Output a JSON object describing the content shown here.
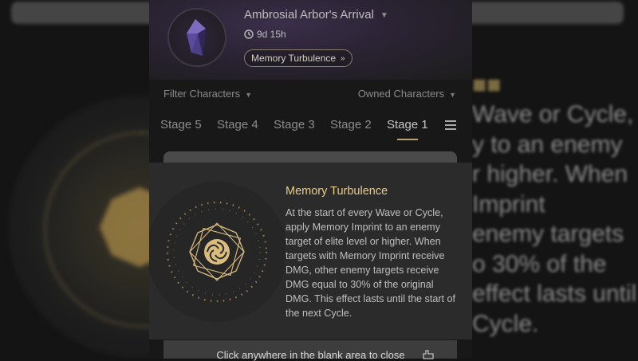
{
  "event": {
    "title": "Ambrosial Arbor's Arrival",
    "time_remaining": "9d 15h",
    "buff_pill": "Memory Turbulence"
  },
  "filters": {
    "left": "Filter Characters",
    "right": "Owned Characters"
  },
  "tabs": [
    "Stage 5",
    "Stage 4",
    "Stage 3",
    "Stage 2",
    "Stage 1"
  ],
  "active_tab": "Stage 1",
  "modal": {
    "title": "Memory Turbulence",
    "description": "At the start of every Wave or Cycle, apply Memory Imprint to an enemy target of elite level or higher. When targets with Memory Imprint receive DMG, other enemy targets receive DMG equal to 30% of the original DMG. This effect lasts until the start of the next Cycle."
  },
  "close_hint": "Click anywhere in the blank area to close",
  "background_text": [
    "Wave or Cycle,",
    "y to an enemy",
    "r higher. When",
    "Imprint",
    "enemy targets",
    "o 30% of the",
    "effect lasts until",
    "Cycle."
  ],
  "colors": {
    "accent_gold": "#e6cc8e",
    "panel_bg": "#181818",
    "modal_bg": "#2b2b2b"
  },
  "icons": [
    "crystal-icon",
    "clock-icon",
    "chevron-double-right-icon",
    "caret-down-icon",
    "menu-icon",
    "memory-turbulence-icon"
  ]
}
